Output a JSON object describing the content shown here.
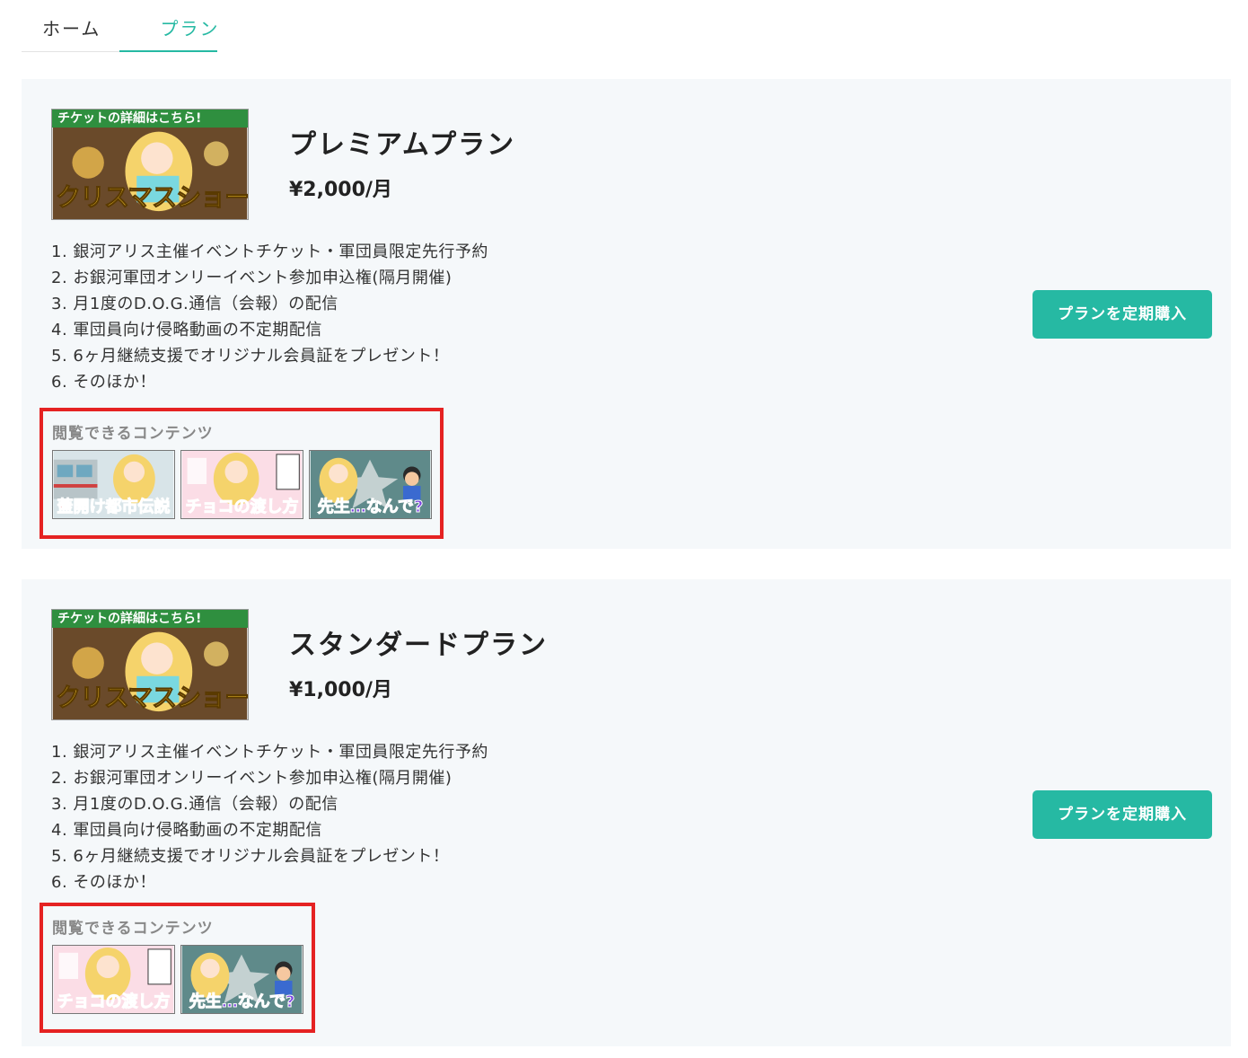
{
  "tabs": [
    {
      "label": "ホーム"
    },
    {
      "label": "プラン"
    }
  ],
  "plans": [
    {
      "title": "プレミアムプラン",
      "price": "¥2,000/月",
      "thumb_top_text": "チケットの詳細はこちら!",
      "thumb_main_text": "クリスマスショー!",
      "benefits": [
        "1. 銀河アリス主催イベントチケット・軍団員限定先行予約",
        "2. お銀河軍団オンリーイベント参加申込権(隔月開催)",
        "3. 月1度のD.O.G.通信（会報）の配信",
        "4. 軍団員向け侵略動画の不定期配信",
        "5. 6ヶ月継続支援でオリジナル会員証をプレゼント！",
        "6. そのほか！"
      ],
      "buy_label": "プランを定期購入",
      "contents_label": "閲覧できるコンテンツ",
      "contents": [
        {
          "caption": "蓋開け都市伝説"
        },
        {
          "caption": "チョコの渡し方"
        },
        {
          "caption": "先生…なんで?"
        }
      ]
    },
    {
      "title": "スタンダードプラン",
      "price": "¥1,000/月",
      "thumb_top_text": "チケットの詳細はこちら!",
      "thumb_main_text": "クリスマスショー!",
      "benefits": [
        "1. 銀河アリス主催イベントチケット・軍団員限定先行予約",
        "2. お銀河軍団オンリーイベント参加申込権(隔月開催)",
        "3. 月1度のD.O.G.通信（会報）の配信",
        "4. 軍団員向け侵略動画の不定期配信",
        "5. 6ヶ月継続支援でオリジナル会員証をプレゼント！",
        "6. そのほか！"
      ],
      "buy_label": "プランを定期購入",
      "contents_label": "閲覧できるコンテンツ",
      "contents": [
        {
          "caption": "チョコの渡し方"
        },
        {
          "caption": "先生…なんで?"
        }
      ]
    }
  ],
  "colors": {
    "accent": "#26b9a3",
    "highlight_box": "#e52222",
    "card_bg": "#f5f8fa"
  }
}
